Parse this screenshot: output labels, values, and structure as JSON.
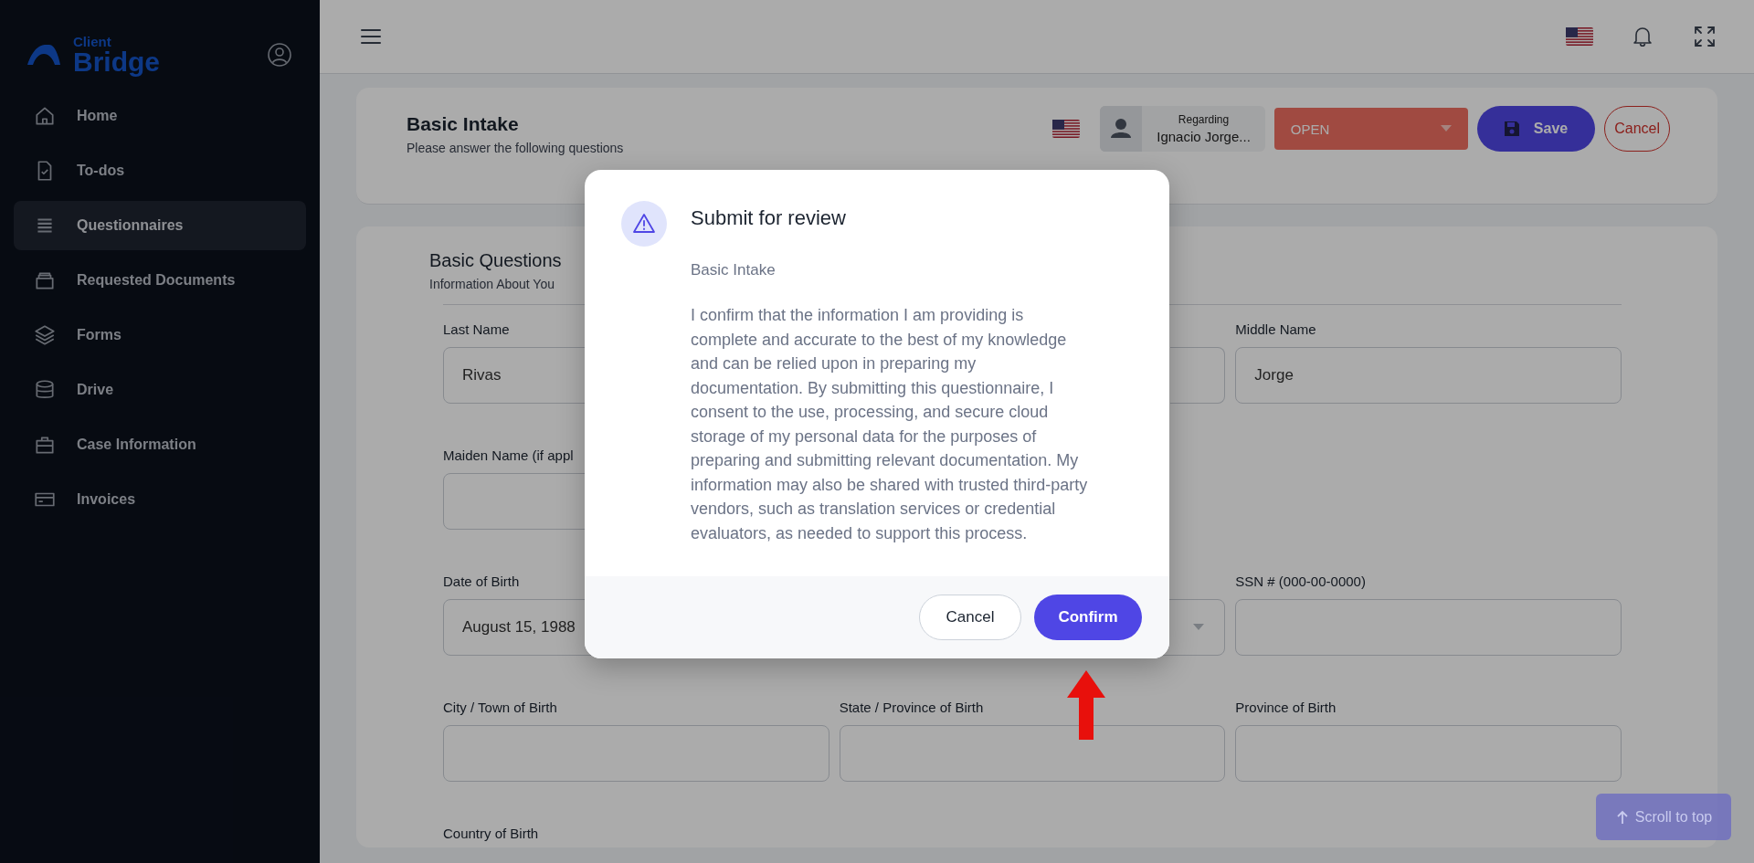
{
  "sidebar": {
    "logo": {
      "small": "Client",
      "large": "Bridge"
    },
    "items": [
      {
        "label": "Home",
        "selected": false
      },
      {
        "label": "To-dos",
        "selected": false
      },
      {
        "label": "Questionnaires",
        "selected": true
      },
      {
        "label": "Requested Documents",
        "selected": false
      },
      {
        "label": "Forms",
        "selected": false
      },
      {
        "label": "Drive",
        "selected": false
      },
      {
        "label": "Case Information",
        "selected": false
      },
      {
        "label": "Invoices",
        "selected": false
      }
    ]
  },
  "header": {
    "title": "Basic Intake",
    "subtitle": "Please answer the following questions",
    "regarding_label": "Regarding",
    "regarding_name": "Ignacio Jorge...",
    "status": "OPEN",
    "save": "Save",
    "cancel": "Cancel"
  },
  "section": {
    "title": "Basic Questions",
    "subtitle": "Information About You",
    "rows": [
      [
        {
          "kind": "text",
          "label": "Last Name",
          "value": "Rivas"
        },
        {
          "kind": "partial"
        },
        {
          "kind": "text",
          "label": "Middle Name",
          "value": "Jorge"
        }
      ],
      [
        {
          "kind": "text",
          "label": "Maiden Name (if appl"
        },
        {
          "kind": "none"
        },
        {
          "kind": "none"
        }
      ],
      [
        {
          "kind": "text",
          "label": "Date of Birth",
          "value": "August 15, 1988"
        },
        {
          "kind": "select"
        },
        {
          "kind": "text",
          "label": "SSN # (000-00-0000)"
        }
      ],
      [
        {
          "kind": "text",
          "label": "City / Town of Birth"
        },
        {
          "kind": "text",
          "label": "State / Province of Birth"
        },
        {
          "kind": "text",
          "label": "Province of Birth"
        }
      ],
      [
        {
          "kind": "label",
          "label": "Country of Birth"
        }
      ]
    ]
  },
  "dialog": {
    "title": "Submit for review",
    "subtitle": "Basic Intake",
    "body": "I confirm that the information I am providing is complete and accurate to the best of my knowledge and can be relied upon in preparing my documentation. By submitting this questionnaire, I consent to the use, processing, and secure cloud storage of my personal data for the purposes of preparing and submitting relevant documentation. My information may also be shared with trusted third-party vendors, such as translation services or credential evaluators, as needed to support this process.",
    "cancel": "Cancel",
    "confirm": "Confirm"
  },
  "scroll_top": {
    "label": "Scroll to top"
  }
}
